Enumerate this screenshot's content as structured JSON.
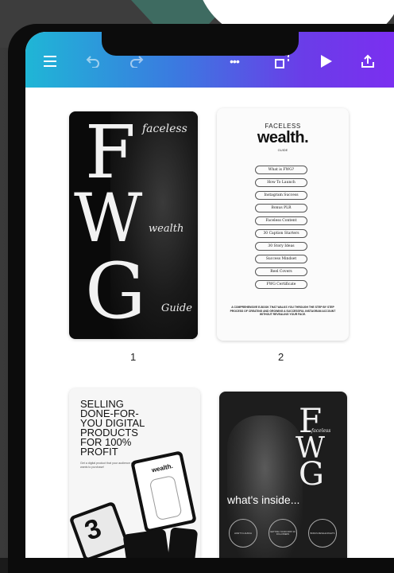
{
  "colors": {
    "toolbar_start": "#1fb6d6",
    "toolbar_end": "#7b2ff0",
    "teal_shape": "#3e6b61"
  },
  "toolbar": {
    "icons": [
      "menu-icon",
      "undo-icon",
      "redo-icon",
      "more-icon",
      "resize-icon",
      "play-icon",
      "share-icon"
    ],
    "more_label": "•••"
  },
  "pages": [
    {
      "number": "1",
      "letters": {
        "f": "F",
        "w": "W",
        "g": "G"
      },
      "script": {
        "faceless": "faceless",
        "wealth": "wealth",
        "guide": "Guide"
      }
    },
    {
      "number": "2",
      "title_small": "FACELESS",
      "title_big": "wealth.",
      "title_sub": "GUIDE",
      "items": [
        "What is FWG?",
        "How To Launch",
        "Instagram Success",
        "Bonus PLR",
        "Faceless Content",
        "30 Caption Starters",
        "30 Story Ideas",
        "Success Mindset",
        "Reel Covers",
        "FWG Certificate"
      ],
      "footer": "A COMPREHENSIVE E-BOOK THAT WALKS YOU THROUGH THE STEP BY STEP PROCESS OF CREATING AND GROWING A SUCCESSFUL INSTAGRAM ACCOUNT WITHOUT REVEALING YOUR FACE."
    },
    {
      "headline": [
        "SELLING",
        "DONE-FOR-",
        "YOU DIGITAL",
        "PRODUCTS",
        "FOR 100%",
        "PROFIT"
      ],
      "subtext": "Get a digital product that your audience actually wants to purchase!",
      "tablet_title": "wealth.",
      "big_number": "3"
    },
    {
      "letters": {
        "f": "F",
        "w": "W",
        "g": "G"
      },
      "script": "faceless",
      "inside": "what's inside...",
      "circles": [
        "HOW TO LAUNCH",
        "GETTING YOUR FIRST 1K FOLLOWERS",
        "BONUS RESALE RIGHTS"
      ]
    }
  ]
}
